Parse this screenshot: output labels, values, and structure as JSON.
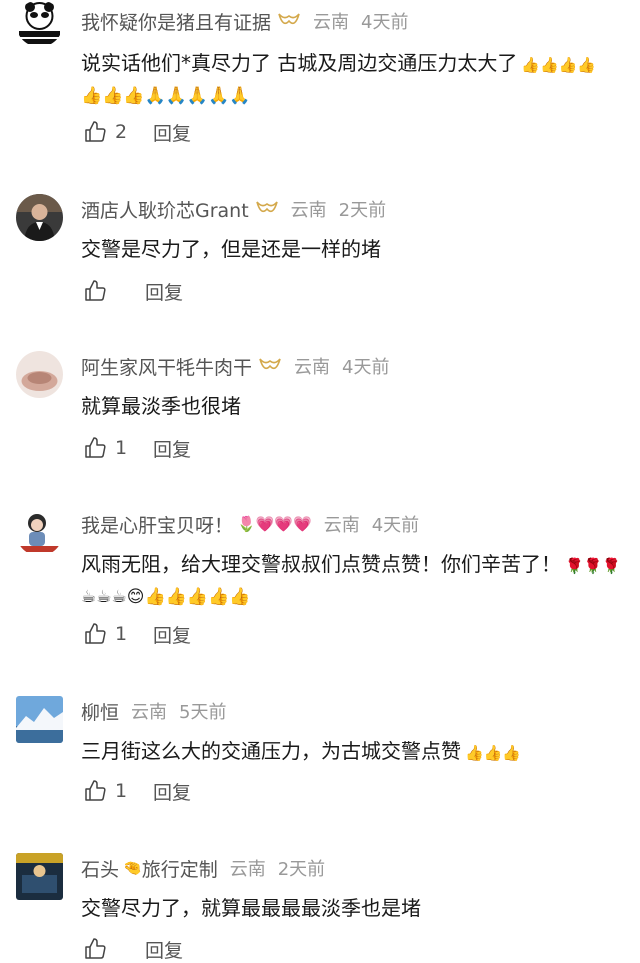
{
  "comments": [
    {
      "username": "我怀疑你是猪且有证据",
      "location": "云南",
      "time": "4天前",
      "line1": "说实话他们*真尽力了 古城及周边交通压力太大了",
      "line1_emojis": "👍👍👍👍",
      "line2_emojis": "👍👍👍🙏🙏🙏🙏🙏",
      "likes": "2",
      "reply": "回复"
    },
    {
      "username": "酒店人耿玠芯Grant",
      "location": "云南",
      "time": "2天前",
      "line1": "交警是尽力了，但是还是一样的堵",
      "likes": "",
      "reply": "回复"
    },
    {
      "username": "阿生家风干牦牛肉干",
      "location": "云南",
      "time": "4天前",
      "line1": "就算最淡季也很堵",
      "likes": "1",
      "reply": "回复"
    },
    {
      "username": "我是心肝宝贝呀！",
      "name_emojis": "🌷💗💗💗",
      "location": "云南",
      "time": "4天前",
      "line1": "风雨无阻，给大理交警叔叔们点赞点赞！你们辛苦了！",
      "line1_emojis": "🌹🌹🌹",
      "line2_emojis": "☕☕☕😊👍👍👍👍👍",
      "likes": "1",
      "reply": "回复"
    },
    {
      "username": "柳恒",
      "location": "云南",
      "time": "5天前",
      "line1": "三月街这么大的交通压力，为古城交警点赞",
      "line1_emojis": "👍👍👍",
      "likes": "1",
      "reply": "回复"
    },
    {
      "username": "石头",
      "name_emojis": "🤏",
      "username_suffix": "旅行定制",
      "location": "云南",
      "time": "2天前",
      "line1": "交警尽力了，就算最最最最淡季也是堵",
      "likes": "",
      "reply": "回复"
    }
  ],
  "colors": {
    "badge": "#d4a94c",
    "meta": "#999999",
    "text": "#1a1a1a"
  }
}
